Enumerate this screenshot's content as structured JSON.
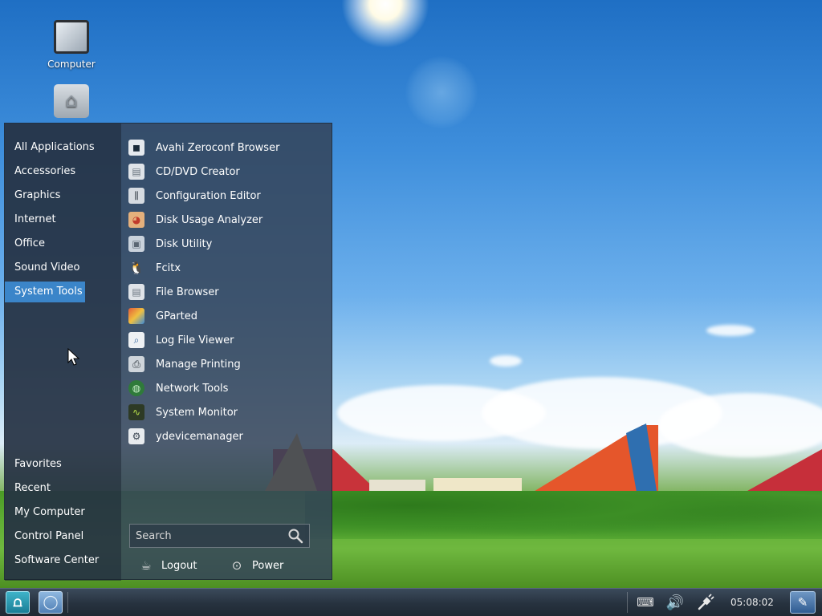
{
  "desktop": {
    "icons": [
      {
        "label": "Computer"
      }
    ]
  },
  "menu": {
    "categories": [
      {
        "label": "All Applications"
      },
      {
        "label": "Accessories"
      },
      {
        "label": "Graphics"
      },
      {
        "label": "Internet"
      },
      {
        "label": "Office"
      },
      {
        "label": "Sound  Video"
      },
      {
        "label": "System Tools"
      }
    ],
    "places": [
      {
        "label": "Favorites"
      },
      {
        "label": "Recent"
      },
      {
        "label": "My Computer"
      },
      {
        "label": "Control Panel"
      },
      {
        "label": "Software Center"
      }
    ],
    "apps": [
      {
        "label": "Avahi Zeroconf Browser"
      },
      {
        "label": "CD/DVD Creator"
      },
      {
        "label": "Configuration Editor"
      },
      {
        "label": "Disk Usage Analyzer"
      },
      {
        "label": "Disk Utility"
      },
      {
        "label": "Fcitx"
      },
      {
        "label": "File Browser"
      },
      {
        "label": "GParted"
      },
      {
        "label": "Log File Viewer"
      },
      {
        "label": "Manage Printing"
      },
      {
        "label": "Network Tools"
      },
      {
        "label": "System Monitor"
      },
      {
        "label": "ydevicemanager"
      }
    ],
    "search": {
      "placeholder": "Search",
      "value": ""
    },
    "logout_label": "Logout",
    "power_label": "Power"
  },
  "taskbar": {
    "clock": "05:08:02"
  }
}
